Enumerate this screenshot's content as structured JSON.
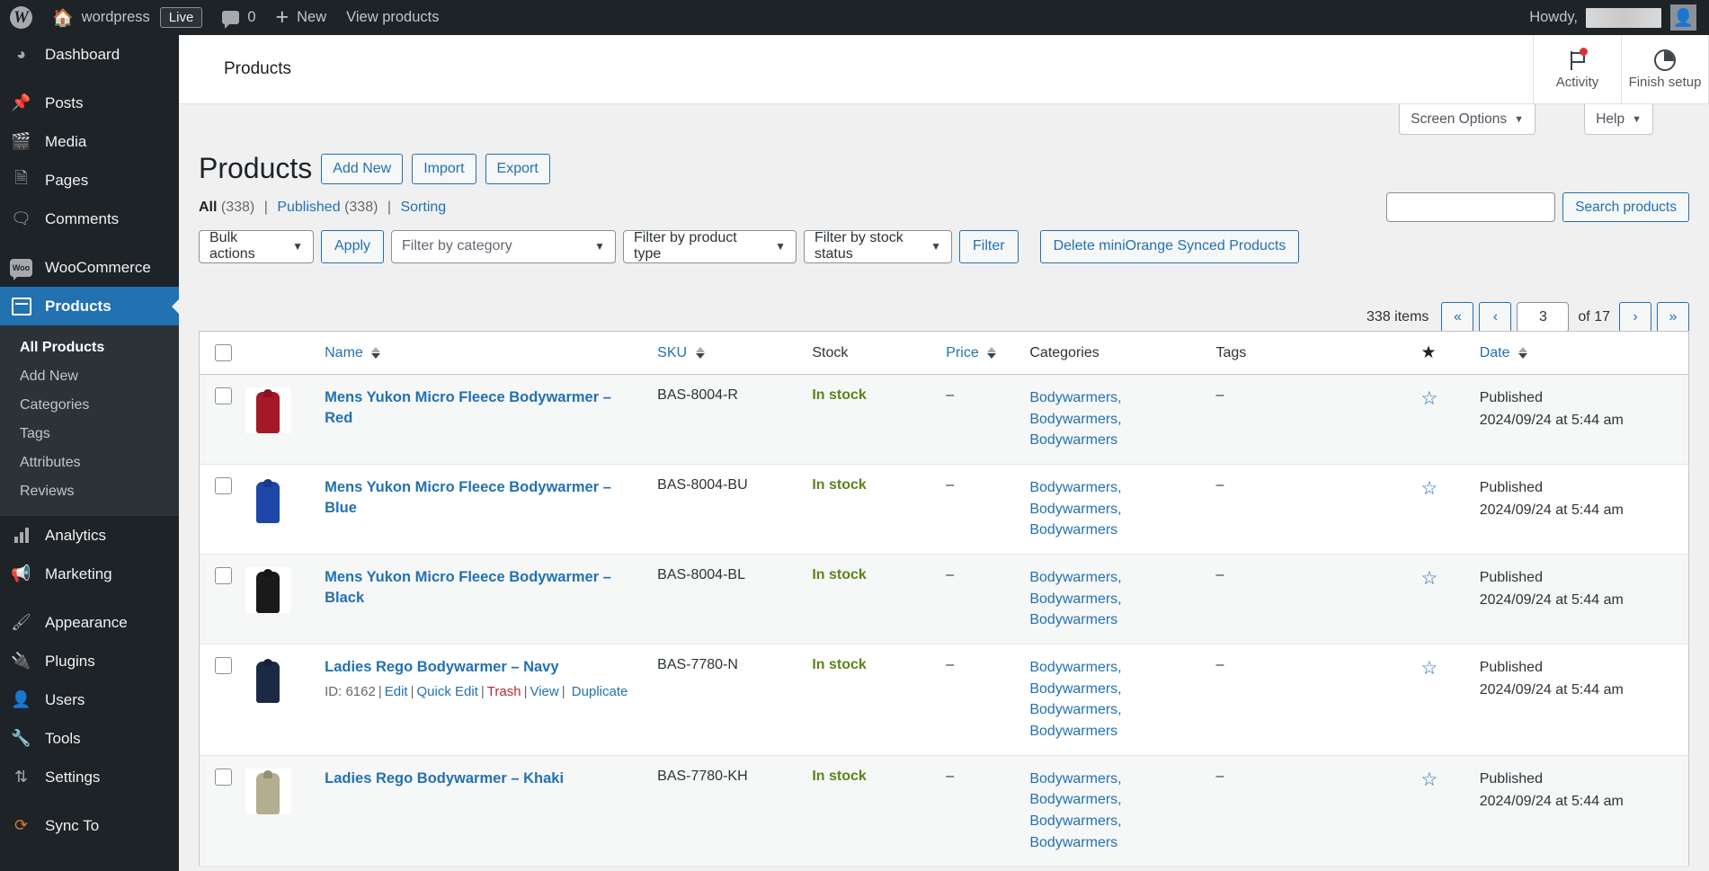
{
  "adminbar": {
    "logo": "wp-logo",
    "site_name": "wordpress",
    "live_badge": "Live",
    "comment_count": "0",
    "new_label": "New",
    "view_label": "View products",
    "howdy": "Howdy,",
    "username": ""
  },
  "sidebar": {
    "items": [
      {
        "label": "Dashboard",
        "icon": "dashboard-icon"
      },
      {
        "label": "Posts",
        "icon": "pin-icon"
      },
      {
        "label": "Media",
        "icon": "media-icon"
      },
      {
        "label": "Pages",
        "icon": "pages-icon"
      },
      {
        "label": "Comments",
        "icon": "comment-icon"
      },
      {
        "label": "WooCommerce",
        "icon": "woo-icon"
      },
      {
        "label": "Products",
        "icon": "products-box-icon"
      },
      {
        "label": "Analytics",
        "icon": "bar-chart-icon"
      },
      {
        "label": "Marketing",
        "icon": "megaphone-icon"
      },
      {
        "label": "Appearance",
        "icon": "paintbrush-icon"
      },
      {
        "label": "Plugins",
        "icon": "plug-icon"
      },
      {
        "label": "Users",
        "icon": "user-icon"
      },
      {
        "label": "Tools",
        "icon": "wrench-icon"
      },
      {
        "label": "Settings",
        "icon": "sliders-icon"
      },
      {
        "label": "Sync To",
        "icon": "sync-icon"
      }
    ],
    "submenu": [
      {
        "label": "All Products"
      },
      {
        "label": "Add New"
      },
      {
        "label": "Categories"
      },
      {
        "label": "Tags"
      },
      {
        "label": "Attributes"
      },
      {
        "label": "Reviews"
      }
    ]
  },
  "wc_header": {
    "title": "Products",
    "actions": [
      {
        "label": "Activity",
        "icon": "flag-icon"
      },
      {
        "label": "Finish setup",
        "icon": "pie-progress-icon"
      }
    ]
  },
  "screen_meta": {
    "screen_options": "Screen Options",
    "help": "Help",
    "caret": "▼"
  },
  "page": {
    "title": "Products",
    "actions": [
      {
        "label": "Add New"
      },
      {
        "label": "Import"
      },
      {
        "label": "Export"
      }
    ]
  },
  "subsubsub": {
    "all_label": "All",
    "all_count": "(338)",
    "published_label": "Published",
    "published_count": "(338)",
    "sorting_label": "Sorting",
    "separator": "|"
  },
  "search": {
    "value": "",
    "placeholder": "",
    "button": "Search products"
  },
  "tablenav": {
    "bulk_actions": "Bulk actions",
    "apply": "Apply",
    "filter_category": "Filter by category",
    "filter_product_type": "Filter by product type",
    "filter_stock_status": "Filter by stock status",
    "filter_button": "Filter",
    "delete_synced": "Delete miniOrange Synced Products"
  },
  "pagination": {
    "items_text": "338 items",
    "first": "«",
    "prev": "‹",
    "current": "3",
    "of_text": "of 17",
    "next": "›",
    "last": "»"
  },
  "table": {
    "columns": {
      "thumb": "",
      "name": "Name",
      "sku": "SKU",
      "stock": "Stock",
      "price": "Price",
      "categories": "Categories",
      "tags": "Tags",
      "featured": "★",
      "date": "Date"
    },
    "rows": [
      {
        "name": "Mens Yukon Micro Fleece Bodywarmer – Red",
        "sku": "BAS-8004-R",
        "stock": "In stock",
        "price": "–",
        "categories": [
          "Bodywarmers,",
          "Bodywarmers,",
          "Bodywarmers"
        ],
        "tags": "–",
        "date_status": "Published",
        "date_value": "2024/09/24 at 5:44 am",
        "thumb_color": "#a51828",
        "actions": null
      },
      {
        "name": "Mens Yukon Micro Fleece Bodywarmer – Blue",
        "sku": "BAS-8004-BU",
        "stock": "In stock",
        "price": "–",
        "categories": [
          "Bodywarmers,",
          "Bodywarmers,",
          "Bodywarmers"
        ],
        "tags": "–",
        "date_status": "Published",
        "date_value": "2024/09/24 at 5:44 am",
        "thumb_color": "#1d46a8",
        "actions": null
      },
      {
        "name": "Mens Yukon Micro Fleece Bodywarmer – Black",
        "sku": "BAS-8004-BL",
        "stock": "In stock",
        "price": "–",
        "categories": [
          "Bodywarmers,",
          "Bodywarmers,",
          "Bodywarmers"
        ],
        "tags": "–",
        "date_status": "Published",
        "date_value": "2024/09/24 at 5:44 am",
        "thumb_color": "#1a1a1a",
        "actions": null
      },
      {
        "name": "Ladies Rego Bodywarmer – Navy",
        "sku": "BAS-7780-N",
        "stock": "In stock",
        "price": "–",
        "categories": [
          "Bodywarmers,",
          "Bodywarmers,",
          "Bodywarmers,",
          "Bodywarmers"
        ],
        "tags": "–",
        "date_status": "Published",
        "date_value": "2024/09/24 at 5:44 am",
        "thumb_color": "#1b2a44",
        "actions": {
          "id": "ID: 6162",
          "edit": "Edit",
          "quick_edit": "Quick Edit",
          "trash": "Trash",
          "view": "View",
          "duplicate": "Duplicate"
        }
      },
      {
        "name": "Ladies Rego Bodywarmer – Khaki",
        "sku": "BAS-7780-KH",
        "stock": "In stock",
        "price": "–",
        "categories": [
          "Bodywarmers,",
          "Bodywarmers,",
          "Bodywarmers,",
          "Bodywarmers"
        ],
        "tags": "–",
        "date_status": "Published",
        "date_value": "2024/09/24 at 5:44 am",
        "thumb_color": "#b3ad92",
        "actions": null
      }
    ]
  },
  "colors": {
    "accent": "#2271b1",
    "sidebar_bg": "#1d2327",
    "current_menu": "#2271b1",
    "in_stock": "#5b841b",
    "trash": "#b32d2e",
    "notice_dot": "#d63638"
  }
}
